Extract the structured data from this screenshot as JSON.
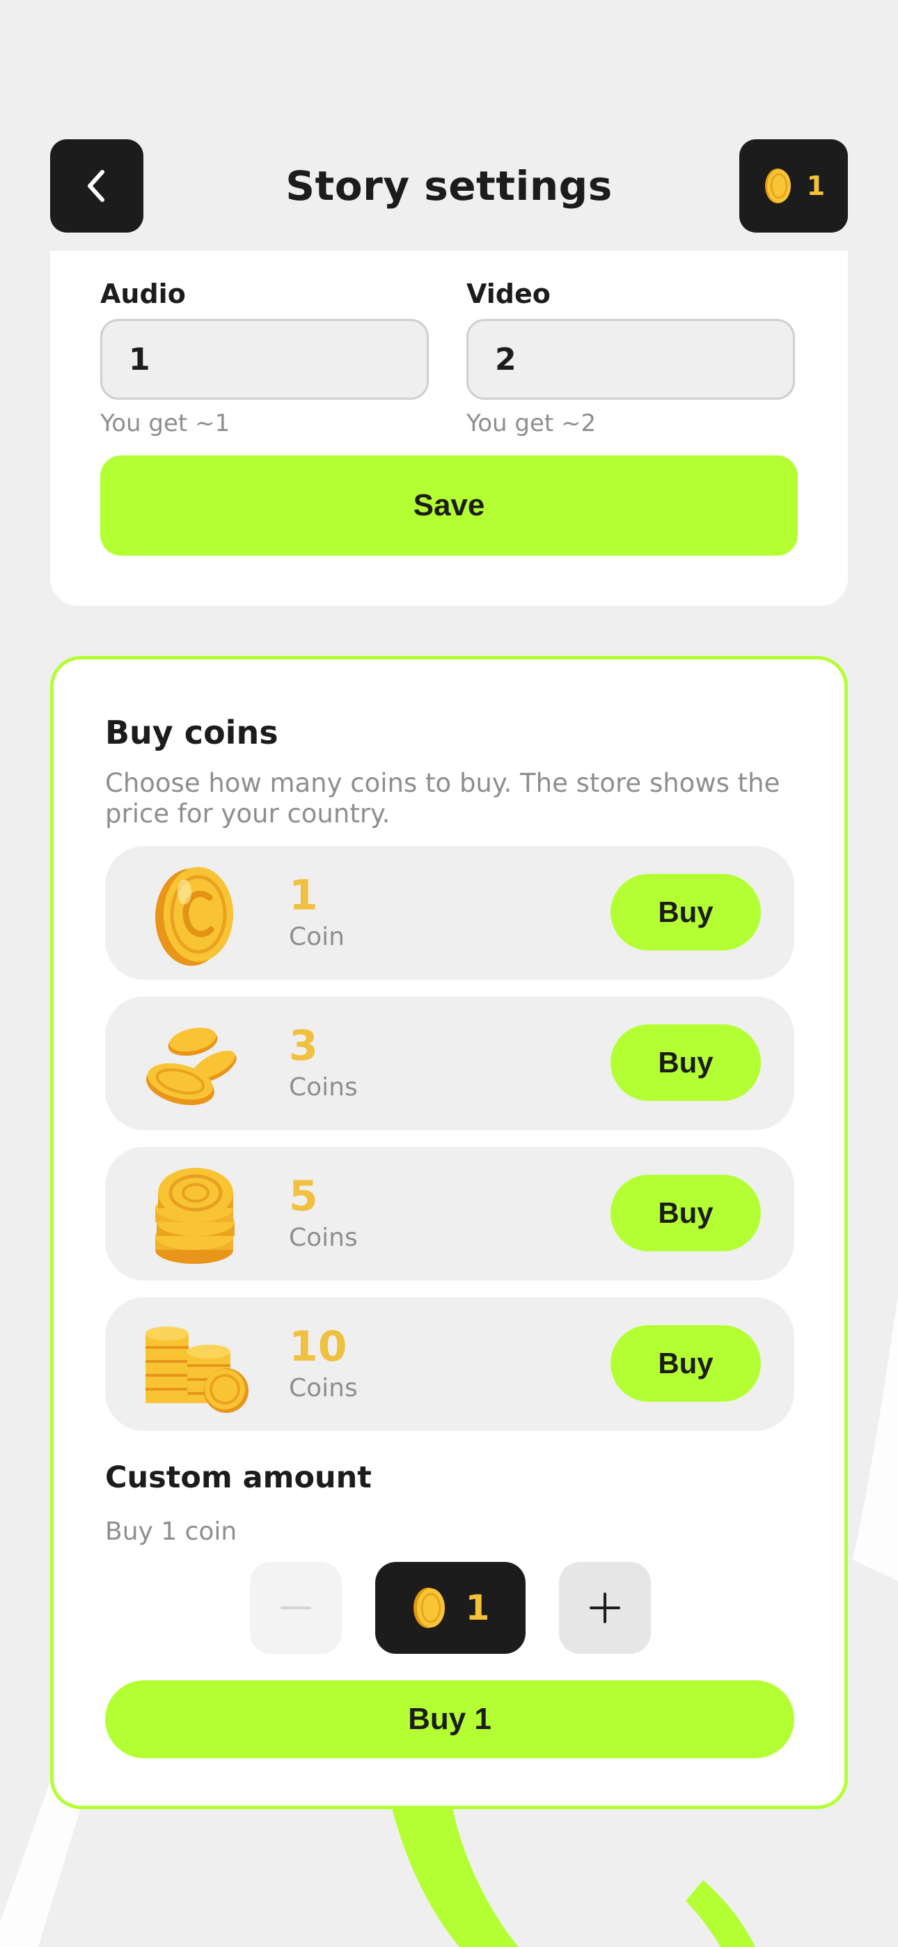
{
  "header": {
    "back_icon": "chevron-left-icon",
    "title": "Story settings",
    "coin_balance": "1"
  },
  "settings": {
    "audio": {
      "label": "Audio",
      "value": "1",
      "hint": "You get ~1"
    },
    "video": {
      "label": "Video",
      "value": "2",
      "hint": "You get ~2"
    },
    "save_label": "Save"
  },
  "buy_coins": {
    "title": "Buy coins",
    "description": "Choose how many coins to buy. The store shows the price for your country.",
    "packages": [
      {
        "amount": "1",
        "unit": "Coin",
        "buy_label": "Buy",
        "icon": "single-coin-icon"
      },
      {
        "amount": "3",
        "unit": "Coins",
        "buy_label": "Buy",
        "icon": "scattered-coins-icon"
      },
      {
        "amount": "5",
        "unit": "Coins",
        "buy_label": "Buy",
        "icon": "coin-stack-icon"
      },
      {
        "amount": "10",
        "unit": "Coins",
        "buy_label": "Buy",
        "icon": "coin-stacks-icon"
      }
    ],
    "custom": {
      "title": "Custom amount",
      "subtitle": "Buy 1 coin",
      "value": "1",
      "buy_label": "Buy 1"
    }
  },
  "colors": {
    "accent": "#b4ff33",
    "dark": "#1c1c1c",
    "coin": "#f0c040",
    "background": "#efefef"
  }
}
